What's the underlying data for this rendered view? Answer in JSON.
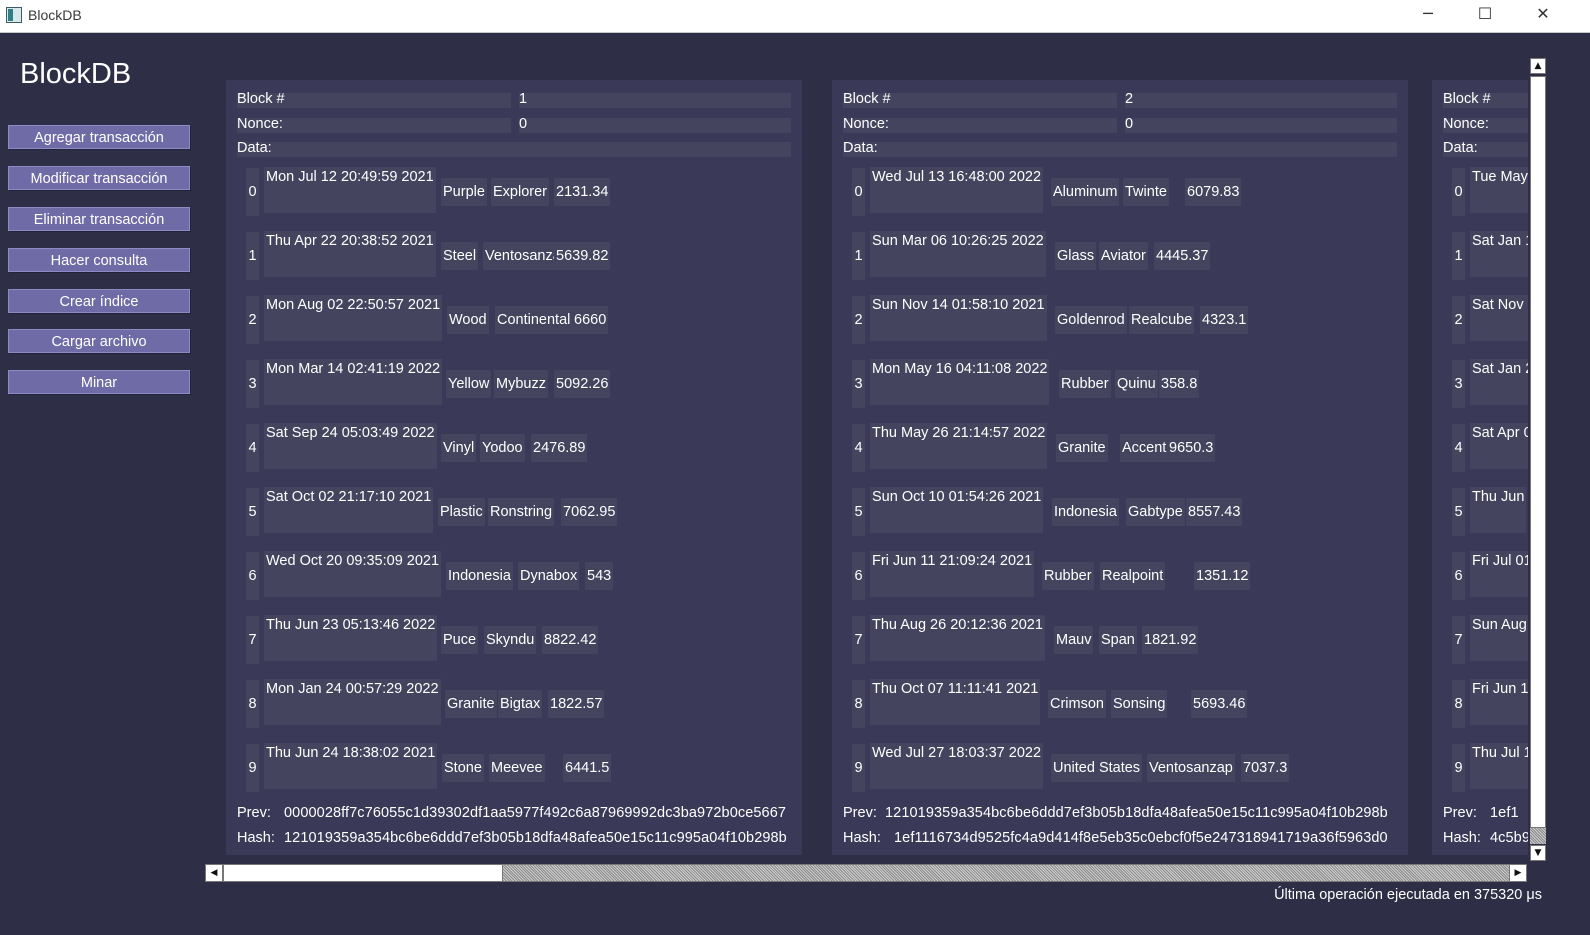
{
  "window": {
    "title": "BlockDB",
    "minimize": "─",
    "maximize": "☐",
    "close": "✕"
  },
  "app_title": "BlockDB",
  "sidebar": {
    "buttons": [
      "Agregar transacción",
      "Modificar transacción",
      "Eliminar transacción",
      "Hacer consulta",
      "Crear índice",
      "Cargar archivo",
      "Minar"
    ]
  },
  "labels": {
    "block": "Block #",
    "nonce": "Nonce:",
    "data": "Data:",
    "prev": "Prev:",
    "hash": "Hash:"
  },
  "blocks": [
    {
      "number": "1",
      "nonce": "0",
      "transactions": [
        [
          "0",
          "Mon Jul 12 20:49:59 2021",
          "Purple",
          "Explorer",
          "2131.34"
        ],
        [
          "1",
          "Thu Apr 22 20:38:52 2021",
          "Steel",
          "Ventosanzap",
          "5639.82"
        ],
        [
          "2",
          "Mon Aug 02 22:50:57 2021",
          "Wood",
          "Continental",
          "6660"
        ],
        [
          "3",
          "Mon Mar 14 02:41:19 2022",
          "Yellow",
          "Mybuzz",
          "5092.26"
        ],
        [
          "4",
          "Sat Sep 24 05:03:49 2022",
          "Vinyl",
          "Yodoo",
          "2476.89"
        ],
        [
          "5",
          "Sat Oct 02 21:17:10 2021",
          "Plastic",
          "Ronstring",
          "7062.95"
        ],
        [
          "6",
          "Wed Oct 20 09:35:09 2021",
          "Indonesia",
          "Dynabox",
          "543"
        ],
        [
          "7",
          "Thu Jun 23 05:13:46 2022",
          "Puce",
          "Skyndu",
          "8822.42"
        ],
        [
          "8",
          "Mon Jan 24 00:57:29 2022",
          "Granite",
          "Bigtax",
          "1822.57"
        ],
        [
          "9",
          "Thu Jun 24 18:38:02 2021",
          "Stone",
          "Meevee",
          "6441.5"
        ]
      ],
      "prev": "0000028ff7c76055c1d39302df1aa5977f492c6a87969992dc3ba972b0ce5667",
      "hash": "121019359a354bc6be6ddd7ef3b05b18dfa48afea50e15c11c995a04f10b298b"
    },
    {
      "number": "2",
      "nonce": "0",
      "transactions": [
        [
          "0",
          "Wed Jul 13 16:48:00 2022",
          "Aluminum",
          "Twinte",
          "6079.83"
        ],
        [
          "1",
          "Sun Mar 06 10:26:25 2022",
          "Glass",
          "Aviator",
          "4445.37"
        ],
        [
          "2",
          "Sun Nov 14 01:58:10 2021",
          "Goldenrod",
          "Realcube",
          "4323.1"
        ],
        [
          "3",
          "Mon May 16 04:11:08 2022",
          "Rubber",
          "Quinu",
          "358.8"
        ],
        [
          "4",
          "Thu May 26 21:14:57 2022",
          "Granite",
          "Accent",
          "9650.3"
        ],
        [
          "5",
          "Sun Oct 10 01:54:26 2021",
          "Indonesia",
          "Gabtype",
          "8557.43"
        ],
        [
          "6",
          "Fri Jun 11 21:09:24 2021",
          "Rubber",
          "Realpoint",
          "1351.12"
        ],
        [
          "7",
          "Thu Aug 26 20:12:36 2021",
          "Mauv",
          "Span",
          "1821.92"
        ],
        [
          "8",
          "Thu Oct 07 11:11:41 2021",
          "Crimson",
          "Sonsing",
          "5693.46"
        ],
        [
          "9",
          "Wed Jul 27 18:03:37 2022",
          "United States",
          "Ventosanzap",
          "7037.3"
        ]
      ],
      "prev": "121019359a354bc6be6ddd7ef3b05b18dfa48afea50e15c11c995a04f10b298b",
      "hash": "1ef1116734d9525fc4a9d414f8e5eb35c0ebcf0f5e247318941719a36f5963d0"
    },
    {
      "number": "",
      "nonce": "",
      "transactions": [
        [
          "0",
          "Tue May",
          "",
          "",
          ""
        ],
        [
          "1",
          "Sat Jan 1",
          "",
          "",
          ""
        ],
        [
          "2",
          "Sat Nov 1",
          "",
          "",
          ""
        ],
        [
          "3",
          "Sat Jan 2",
          "",
          "",
          ""
        ],
        [
          "4",
          "Sat Apr 0",
          "",
          "",
          ""
        ],
        [
          "5",
          "Thu Jun",
          "",
          "",
          ""
        ],
        [
          "6",
          "Fri Jul 01",
          "",
          "",
          ""
        ],
        [
          "7",
          "Sun Aug",
          "",
          "",
          ""
        ],
        [
          "8",
          "Fri Jun 1",
          "",
          "",
          ""
        ],
        [
          "9",
          "Thu Jul 1",
          "",
          "",
          ""
        ]
      ],
      "prev": "1ef1",
      "hash": "4c5b9"
    }
  ],
  "scroll": {
    "up": "▲",
    "down": "▼",
    "left": "◀",
    "right": "▶"
  },
  "status": {
    "text": "Última operación ejecutada en  375320 μs"
  }
}
